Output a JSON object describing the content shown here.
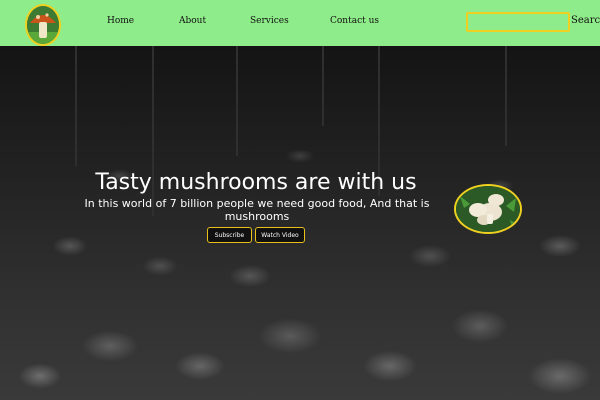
{
  "nav": {
    "logo_icon": "mushroom-logo-icon",
    "links": [
      "Home",
      "About",
      "Services",
      "Contact us"
    ],
    "search_placeholder": "",
    "search_label": "Search"
  },
  "hero": {
    "background_icon": "mushroom-farm-background",
    "title": "Tasty mushrooms are with us",
    "subtitle": "In this world of 7 billion people we need good food, And that is mushrooms",
    "subscribe_label": "Subscribe",
    "watch_label": "Watch Video",
    "side_image_icon": "white-mushrooms-image"
  },
  "colors": {
    "nav_bg": "#8fec8a",
    "accent_yellow": "#f0d020",
    "button_border": "#e8c01a"
  }
}
